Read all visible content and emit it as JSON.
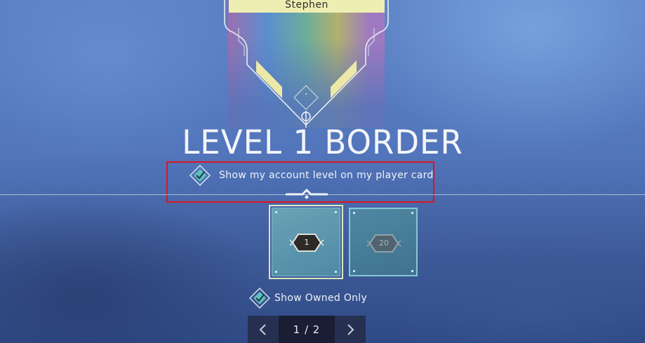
{
  "player_card": {
    "name": "Stephen"
  },
  "level_border": {
    "title": "LEVEL 1 BORDER",
    "toggle_label": "Show my account level on my player card",
    "toggle_checked": true
  },
  "border_options": [
    {
      "level": "1",
      "selected": true
    },
    {
      "level": "20",
      "selected": false
    }
  ],
  "filter": {
    "owned_label": "Show Owned Only",
    "owned_checked": true
  },
  "pagination": {
    "current": "1",
    "separator": "/",
    "total": "2",
    "display": "1 / 2"
  },
  "colors": {
    "accent_frame": "#eeeeb2",
    "check_teal": "#5fbfbe",
    "highlight_red": "#e0141e"
  }
}
